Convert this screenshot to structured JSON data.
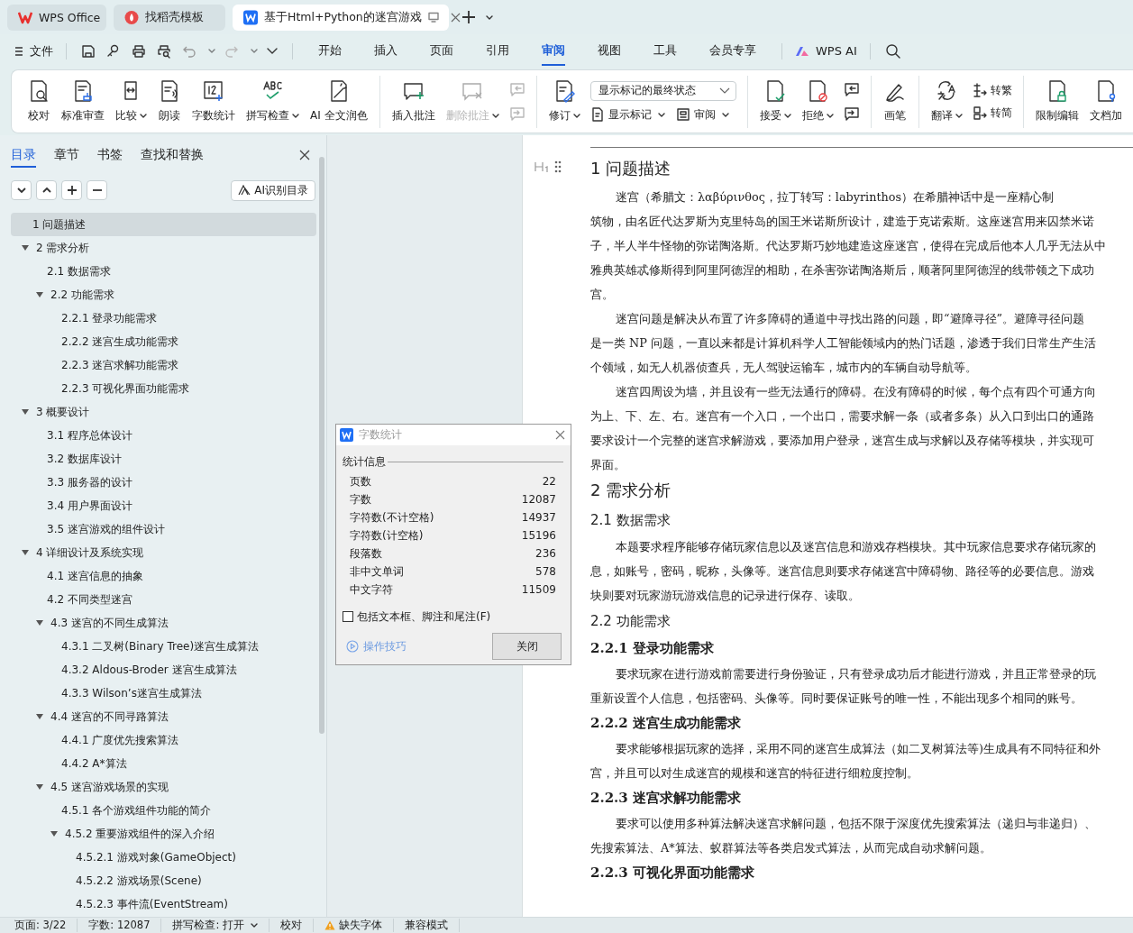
{
  "app_tabs": [
    {
      "label": "WPS Office",
      "selected": false
    },
    {
      "label": "找稻壳模板",
      "selected": false
    },
    {
      "label": "基于Html+Python的迷宫游戏",
      "selected": true
    }
  ],
  "menu": {
    "file": "文件",
    "tabs": [
      {
        "label": "开始",
        "selected": false
      },
      {
        "label": "插入",
        "selected": false
      },
      {
        "label": "页面",
        "selected": false
      },
      {
        "label": "引用",
        "selected": false
      },
      {
        "label": "审阅",
        "selected": true
      },
      {
        "label": "视图",
        "selected": false
      },
      {
        "label": "工具",
        "selected": false
      },
      {
        "label": "会员专享",
        "selected": false
      }
    ],
    "ai": "WPS AI"
  },
  "ribbon": [
    {
      "items": [
        {
          "kind": "large",
          "label": "校对",
          "dropdown": false,
          "disabled": false
        },
        {
          "kind": "large",
          "label": "标准审查",
          "dropdown": false,
          "disabled": false
        },
        {
          "kind": "large",
          "label": "比较",
          "dropdown": true,
          "disabled": false
        },
        {
          "kind": "large",
          "label": "朗读",
          "dropdown": false,
          "disabled": false
        },
        {
          "kind": "large",
          "label": "字数统计",
          "dropdown": false,
          "disabled": false
        },
        {
          "kind": "large",
          "label": "拼写检查",
          "dropdown": true,
          "disabled": false
        },
        {
          "kind": "large",
          "label": "AI 全文润色",
          "dropdown": false,
          "disabled": false
        }
      ]
    },
    {
      "items": [
        {
          "kind": "large",
          "label": "插入批注",
          "dropdown": false,
          "disabled": false
        },
        {
          "kind": "large",
          "label": "删除批注",
          "dropdown": true,
          "disabled": true
        },
        {
          "kind": "pair",
          "disabled": true
        }
      ]
    },
    {
      "items": [
        {
          "kind": "large",
          "label": "修订",
          "dropdown": true,
          "disabled": false
        },
        {
          "kind": "stack",
          "select": "显示标记的最终状态",
          "buttons": [
            {
              "label": "显示标记",
              "dropdown": true
            },
            {
              "label": "审阅",
              "dropdown": true
            }
          ]
        }
      ]
    },
    {
      "items": [
        {
          "kind": "large",
          "label": "接受",
          "dropdown": true,
          "disabled": false
        },
        {
          "kind": "large",
          "label": "拒绝",
          "dropdown": true,
          "disabled": false
        },
        {
          "kind": "pair",
          "disabled": false
        }
      ]
    },
    {
      "items": [
        {
          "kind": "large",
          "label": "画笔",
          "dropdown": false,
          "disabled": false
        }
      ]
    },
    {
      "items": [
        {
          "kind": "large",
          "label": "翻译",
          "dropdown": true,
          "disabled": false
        },
        {
          "kind": "smalls",
          "buttons": [
            {
              "label": "转繁",
              "dropdown": false
            },
            {
              "label": "转简",
              "dropdown": false
            }
          ]
        }
      ]
    },
    {
      "items": [
        {
          "kind": "large",
          "label": "限制编辑",
          "dropdown": false,
          "disabled": false
        },
        {
          "kind": "large",
          "label": "文档加",
          "dropdown": false,
          "disabled": false
        }
      ]
    }
  ],
  "sidebar": {
    "tabs": [
      {
        "label": "目录",
        "selected": true
      },
      {
        "label": "章节",
        "selected": false
      },
      {
        "label": "书签",
        "selected": false
      },
      {
        "label": "查找和替换",
        "selected": false
      }
    ],
    "ai_button": "AI识别目录",
    "toc": [
      {
        "label": "1  问题描述",
        "selected": true
      },
      {
        "label": "2  需求分析",
        "selected": false,
        "expanded": true,
        "children": [
          {
            "label": "2.1  数据需求",
            "selected": false
          },
          {
            "label": "2.2  功能需求",
            "selected": false,
            "expanded": true,
            "children": [
              {
                "label": "2.2.1 登录功能需求",
                "selected": false
              },
              {
                "label": "2.2.2 迷宫生成功能需求",
                "selected": false
              },
              {
                "label": "2.2.3 迷宫求解功能需求",
                "selected": false
              },
              {
                "label": "2.2.3 可视化界面功能需求",
                "selected": false
              }
            ]
          }
        ]
      },
      {
        "label": "3  概要设计",
        "selected": false,
        "expanded": true,
        "children": [
          {
            "label": "3.1 程序总体设计",
            "selected": false
          },
          {
            "label": "3.2  数据库设计",
            "selected": false
          },
          {
            "label": "3.3  服务器的设计",
            "selected": false
          },
          {
            "label": "3.4  用户界面设计",
            "selected": false
          },
          {
            "label": "3.5  迷宫游戏的组件设计",
            "selected": false
          }
        ]
      },
      {
        "label": "4  详细设计及系统实现",
        "selected": false,
        "expanded": true,
        "children": [
          {
            "label": "4.1  迷宫信息的抽象",
            "selected": false
          },
          {
            "label": "4.2  不同类型迷宫",
            "selected": false
          },
          {
            "label": "4.3  迷宫的不同生成算法",
            "selected": false,
            "expanded": true,
            "children": [
              {
                "label": "4.3.1 二叉树(Binary Tree)迷宫生成算法",
                "selected": false
              },
              {
                "label": "4.3.2 Aldous-Broder 迷宫生成算法",
                "selected": false
              },
              {
                "label": "4.3.3 Wilson’s迷宫生成算法",
                "selected": false
              }
            ]
          },
          {
            "label": "4.4  迷宫的不同寻路算法",
            "selected": false,
            "expanded": true,
            "children": [
              {
                "label": "4.4.1 广度优先搜索算法",
                "selected": false
              },
              {
                "label": "4.4.2 A*算法",
                "selected": false
              }
            ]
          },
          {
            "label": "4.5  迷宫游戏场景的实现",
            "selected": false,
            "expanded": true,
            "children": [
              {
                "label": "4.5.1  各个游戏组件功能的简介",
                "selected": false
              },
              {
                "label": "4.5.2  重要游戏组件的深入介绍",
                "selected": false,
                "expanded": true,
                "children": [
                  {
                    "label": "4.5.2.1  游戏对象(GameObject)",
                    "selected": false
                  },
                  {
                    "label": "4.5.2.2  游戏场景(Scene)",
                    "selected": false
                  },
                  {
                    "label": "4.5.2.3  事件流(EventStream)",
                    "selected": false
                  }
                ]
              }
            ]
          }
        ]
      }
    ]
  },
  "document": [
    {
      "kind": "h1",
      "text": "1  问题描述"
    },
    {
      "kind": "para",
      "lines": [
        "迷宫（希腊文：λαβύρινθος，拉丁转写：labyrinthos）在希腊神话中是一座精心制",
        "筑物，由名匠代达罗斯为克里特岛的国王米诺斯所设计，建造于克诺索斯。这座迷宫用来囚禁米诺",
        "子，半人半牛怪物的弥诺陶洛斯。代达罗斯巧妙地建造这座迷宫，使得在完成后他本人几乎无法从中",
        "雅典英雄忒修斯得到阿里阿德涅的相助，在杀害弥诺陶洛斯后，顺著阿里阿德涅的线带领之下成功",
        "宫。"
      ]
    },
    {
      "kind": "para",
      "lines": [
        "迷宫问题是解决从布置了许多障碍的通道中寻找出路的问题，即“避障寻径”。避障寻径问题",
        "是一类 NP 问题，一直以来都是计算机科学人工智能领域内的热门话题，渗透于我们日常生产生活",
        "个领域，如无人机器侦查兵，无人驾驶运输车，城市内的车辆自动导航等。"
      ]
    },
    {
      "kind": "para",
      "lines": [
        "迷宫四周设为墙，并且设有一些无法通行的障碍。在没有障碍的时候，每个点有四个可通方向",
        "为上、下、左、右。迷宫有一个入口，一个出口，需要求解一条（或者多条）从入口到出口的通路",
        "要求设计一个完整的迷宫求解游戏，要添加用户登录，迷宫生成与求解以及存储等模块，并实现可",
        "界面。"
      ]
    },
    {
      "kind": "h1",
      "text": "2  需求分析"
    },
    {
      "kind": "h2",
      "text": "2.1  数据需求"
    },
    {
      "kind": "para",
      "lines": [
        "本题要求程序能够存储玩家信息以及迷宫信息和游戏存档模块。其中玩家信息要求存储玩家的",
        "息，如账号，密码，昵称，头像等。迷宫信息则要求存储迷宫中障碍物、路径等的必要信息。游戏",
        "块则要对玩家游玩游戏信息的记录进行保存、读取。"
      ]
    },
    {
      "kind": "h2",
      "text": "2.2  功能需求"
    },
    {
      "kind": "h3",
      "text": "2.2.1 登录功能需求"
    },
    {
      "kind": "para",
      "lines": [
        "要求玩家在进行游戏前需要进行身份验证，只有登录成功后才能进行游戏，并且正常登录的玩",
        "重新设置个人信息，包括密码、头像等。同时要保证账号的唯一性，不能出现多个相同的账号。"
      ]
    },
    {
      "kind": "h3",
      "text": "2.2.2 迷宫生成功能需求"
    },
    {
      "kind": "para",
      "lines": [
        "要求能够根据玩家的选择，采用不同的迷宫生成算法（如二叉树算法等)生成具有不同特征和外",
        "宫，并且可以对生成迷宫的规模和迷宫的特征进行细粒度控制。"
      ]
    },
    {
      "kind": "h3",
      "text": "2.2.3 迷宫求解功能需求"
    },
    {
      "kind": "para",
      "lines": [
        "要求可以使用多种算法解决迷宫求解问题，包括不限于深度优先搜索算法（递归与非递归）、",
        "先搜索算法、A*算法、蚁群算法等各类启发式算法，从而完成自动求解问题。"
      ]
    },
    {
      "kind": "h3",
      "text": "2.2.3 可视化界面功能需求"
    }
  ],
  "dialog": {
    "title": "字数统计",
    "group": "统计信息",
    "rows": [
      {
        "label": "页数",
        "value": "22"
      },
      {
        "label": "字数",
        "value": "12087"
      },
      {
        "label": "字符数(不计空格)",
        "value": "14937"
      },
      {
        "label": "字符数(计空格)",
        "value": "15196"
      },
      {
        "label": "段落数",
        "value": "236"
      },
      {
        "label": "非中文单词",
        "value": "578"
      },
      {
        "label": "中文字符",
        "value": "11509"
      }
    ],
    "checkbox": {
      "label": "包括文本框、脚注和尾注(F)",
      "checked": false
    },
    "tips": "操作技巧",
    "close": "关闭"
  },
  "status_bar": [
    {
      "kind": "text",
      "text": "页面: 3/22"
    },
    {
      "kind": "text",
      "text": "字数: 12087"
    },
    {
      "kind": "dropdown",
      "text": "拼写检查: 打开"
    },
    {
      "kind": "text",
      "text": "校对"
    },
    {
      "kind": "warning",
      "text": "缺失字体"
    },
    {
      "kind": "text",
      "text": "兼容模式"
    }
  ]
}
